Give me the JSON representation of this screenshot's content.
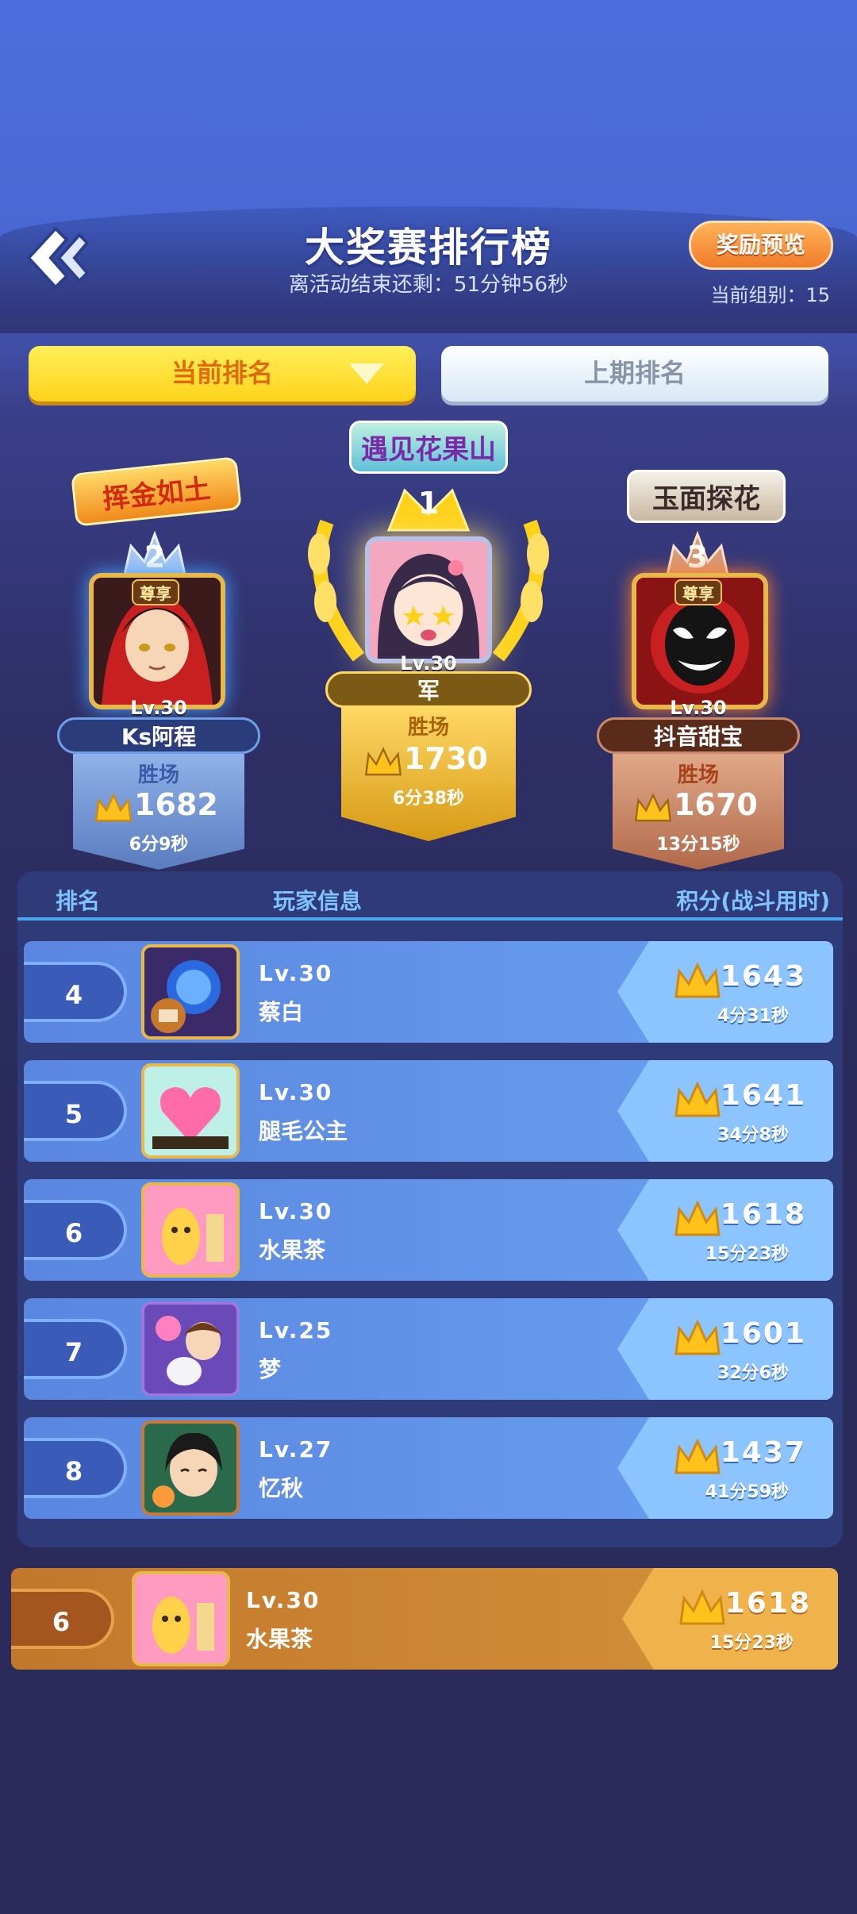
{
  "header": {
    "title": "大奖赛排行榜",
    "countdown": "离活动结束还剩：51分钟56秒",
    "reward_button": "奖励预览",
    "group": "当前组别：15"
  },
  "tabs": {
    "current": "当前排名",
    "previous": "上期排名"
  },
  "podium": {
    "first": {
      "rank": "1",
      "title_badge": "遇见花果山",
      "level": "Lv.30",
      "name": "军",
      "label": "胜场",
      "score": "1730",
      "time": "6分38秒"
    },
    "second": {
      "rank": "2",
      "title_badge": "挥金如土",
      "exclusive": "尊享",
      "level": "Lv.30",
      "name": "Ks阿程",
      "label": "胜场",
      "score": "1682",
      "time": "6分9秒"
    },
    "third": {
      "rank": "3",
      "title_badge": "玉面探花",
      "exclusive": "尊享",
      "level": "Lv.30",
      "name": "抖音甜宝",
      "label": "胜场",
      "score": "1670",
      "time": "13分15秒"
    }
  },
  "table": {
    "headers": {
      "rank": "排名",
      "player": "玩家信息",
      "score": "积分(战斗用时)"
    },
    "rows": [
      {
        "rank": "4",
        "level": "Lv.30",
        "name": "蔡白",
        "score": "1643",
        "time": "4分31秒"
      },
      {
        "rank": "5",
        "level": "Lv.30",
        "name": "腿毛公主",
        "score": "1641",
        "time": "34分8秒"
      },
      {
        "rank": "6",
        "level": "Lv.30",
        "name": "水果茶",
        "score": "1618",
        "time": "15分23秒"
      },
      {
        "rank": "7",
        "level": "Lv.25",
        "name": "梦",
        "score": "1601",
        "time": "32分6秒"
      },
      {
        "rank": "8",
        "level": "Lv.27",
        "name": "忆秋",
        "score": "1437",
        "time": "41分59秒"
      }
    ]
  },
  "my_rank": {
    "rank": "6",
    "level": "Lv.30",
    "name": "水果茶",
    "score": "1618",
    "time": "15分23秒"
  },
  "colors": {
    "gold": "#ffd21a",
    "silver": "#8fb2e8",
    "bronze": "#c98a6a",
    "row_blue": "#5a86e0",
    "my_row": "#d6923a"
  }
}
